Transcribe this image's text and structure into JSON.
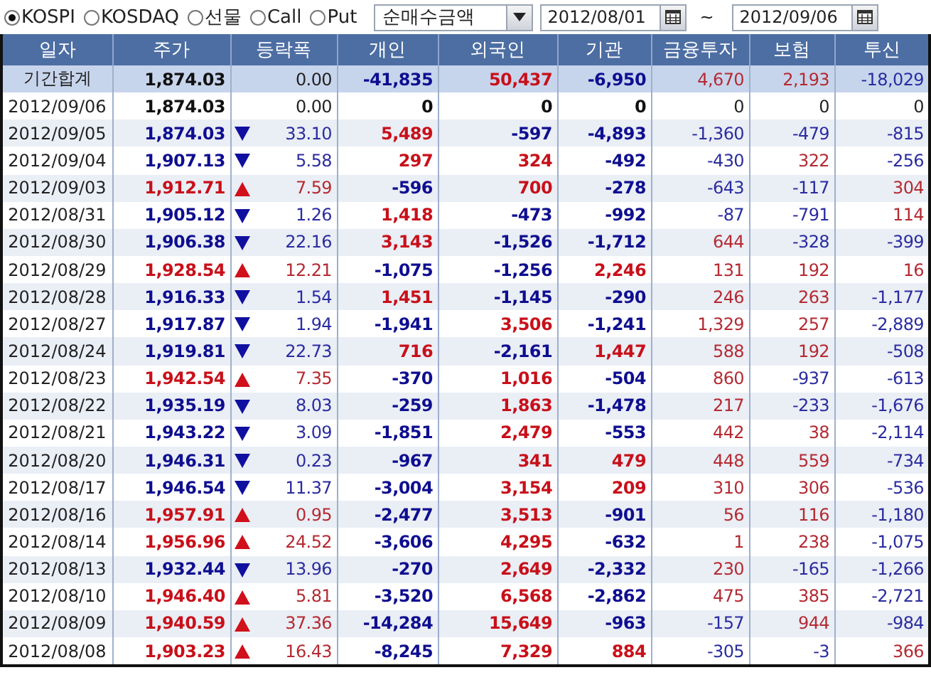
{
  "toolbar": {
    "markets": [
      {
        "label": "KOSPI",
        "selected": true
      },
      {
        "label": "KOSDAQ",
        "selected": false
      },
      {
        "label": "선물",
        "selected": false
      },
      {
        "label": "Call",
        "selected": false
      },
      {
        "label": "Put",
        "selected": false
      }
    ],
    "measure": "순매수금액",
    "start_date": "2012/08/01",
    "separator": "~",
    "end_date": "2012/09/06"
  },
  "table": {
    "columns": [
      "일자",
      "주가",
      "등락폭",
      "개인",
      "외국인",
      "기관",
      "금융투자",
      "보험",
      "투신"
    ],
    "summary": {
      "up": false,
      "down": false,
      "cells": [
        "기간합계",
        "1,874.03",
        "0.00",
        "-41,835",
        "50,437",
        "-6,950",
        "4,670",
        "2,193",
        "-18,029"
      ]
    },
    "rows": [
      {
        "up": false,
        "down": false,
        "cells": [
          "2012/09/06",
          "1,874.03",
          "0.00",
          "0",
          "0",
          "0",
          "0",
          "0",
          "0"
        ]
      },
      {
        "up": false,
        "down": true,
        "cells": [
          "2012/09/05",
          "1,874.03",
          "33.10",
          "5,489",
          "-597",
          "-4,893",
          "-1,360",
          "-479",
          "-815"
        ]
      },
      {
        "up": false,
        "down": true,
        "cells": [
          "2012/09/04",
          "1,907.13",
          "5.58",
          "297",
          "324",
          "-492",
          "-430",
          "322",
          "-256"
        ]
      },
      {
        "up": true,
        "down": false,
        "cells": [
          "2012/09/03",
          "1,912.71",
          "7.59",
          "-596",
          "700",
          "-278",
          "-643",
          "-117",
          "304"
        ]
      },
      {
        "up": false,
        "down": true,
        "cells": [
          "2012/08/31",
          "1,905.12",
          "1.26",
          "1,418",
          "-473",
          "-992",
          "-87",
          "-791",
          "114"
        ]
      },
      {
        "up": false,
        "down": true,
        "cells": [
          "2012/08/30",
          "1,906.38",
          "22.16",
          "3,143",
          "-1,526",
          "-1,712",
          "644",
          "-328",
          "-399"
        ]
      },
      {
        "up": true,
        "down": false,
        "cells": [
          "2012/08/29",
          "1,928.54",
          "12.21",
          "-1,075",
          "-1,256",
          "2,246",
          "131",
          "192",
          "16"
        ]
      },
      {
        "up": false,
        "down": true,
        "cells": [
          "2012/08/28",
          "1,916.33",
          "1.54",
          "1,451",
          "-1,145",
          "-290",
          "246",
          "263",
          "-1,177"
        ]
      },
      {
        "up": false,
        "down": true,
        "cells": [
          "2012/08/27",
          "1,917.87",
          "1.94",
          "-1,941",
          "3,506",
          "-1,241",
          "1,329",
          "257",
          "-2,889"
        ]
      },
      {
        "up": false,
        "down": true,
        "cells": [
          "2012/08/24",
          "1,919.81",
          "22.73",
          "716",
          "-2,161",
          "1,447",
          "588",
          "192",
          "-508"
        ]
      },
      {
        "up": true,
        "down": false,
        "cells": [
          "2012/08/23",
          "1,942.54",
          "7.35",
          "-370",
          "1,016",
          "-504",
          "860",
          "-937",
          "-613"
        ]
      },
      {
        "up": false,
        "down": true,
        "cells": [
          "2012/08/22",
          "1,935.19",
          "8.03",
          "-259",
          "1,863",
          "-1,478",
          "217",
          "-233",
          "-1,676"
        ]
      },
      {
        "up": false,
        "down": true,
        "cells": [
          "2012/08/21",
          "1,943.22",
          "3.09",
          "-1,851",
          "2,479",
          "-553",
          "442",
          "38",
          "-2,114"
        ]
      },
      {
        "up": false,
        "down": true,
        "cells": [
          "2012/08/20",
          "1,946.31",
          "0.23",
          "-967",
          "341",
          "479",
          "448",
          "559",
          "-734"
        ]
      },
      {
        "up": false,
        "down": true,
        "cells": [
          "2012/08/17",
          "1,946.54",
          "11.37",
          "-3,004",
          "3,154",
          "209",
          "310",
          "306",
          "-536"
        ]
      },
      {
        "up": true,
        "down": false,
        "cells": [
          "2012/08/16",
          "1,957.91",
          "0.95",
          "-2,477",
          "3,513",
          "-901",
          "56",
          "116",
          "-1,180"
        ]
      },
      {
        "up": true,
        "down": false,
        "cells": [
          "2012/08/14",
          "1,956.96",
          "24.52",
          "-3,606",
          "4,295",
          "-632",
          "1",
          "238",
          "-1,075"
        ]
      },
      {
        "up": false,
        "down": true,
        "cells": [
          "2012/08/13",
          "1,932.44",
          "13.96",
          "-270",
          "2,649",
          "-2,332",
          "230",
          "-165",
          "-1,266"
        ]
      },
      {
        "up": true,
        "down": false,
        "cells": [
          "2012/08/10",
          "1,946.40",
          "5.81",
          "-3,520",
          "6,568",
          "-2,862",
          "475",
          "385",
          "-2,721"
        ]
      },
      {
        "up": true,
        "down": false,
        "cells": [
          "2012/08/09",
          "1,940.59",
          "37.36",
          "-14,284",
          "15,649",
          "-963",
          "-157",
          "944",
          "-984"
        ]
      },
      {
        "up": true,
        "down": false,
        "cells": [
          "2012/08/08",
          "1,903.23",
          "16.43",
          "-8,245",
          "7,329",
          "884",
          "-305",
          "-3",
          "366"
        ]
      }
    ]
  }
}
